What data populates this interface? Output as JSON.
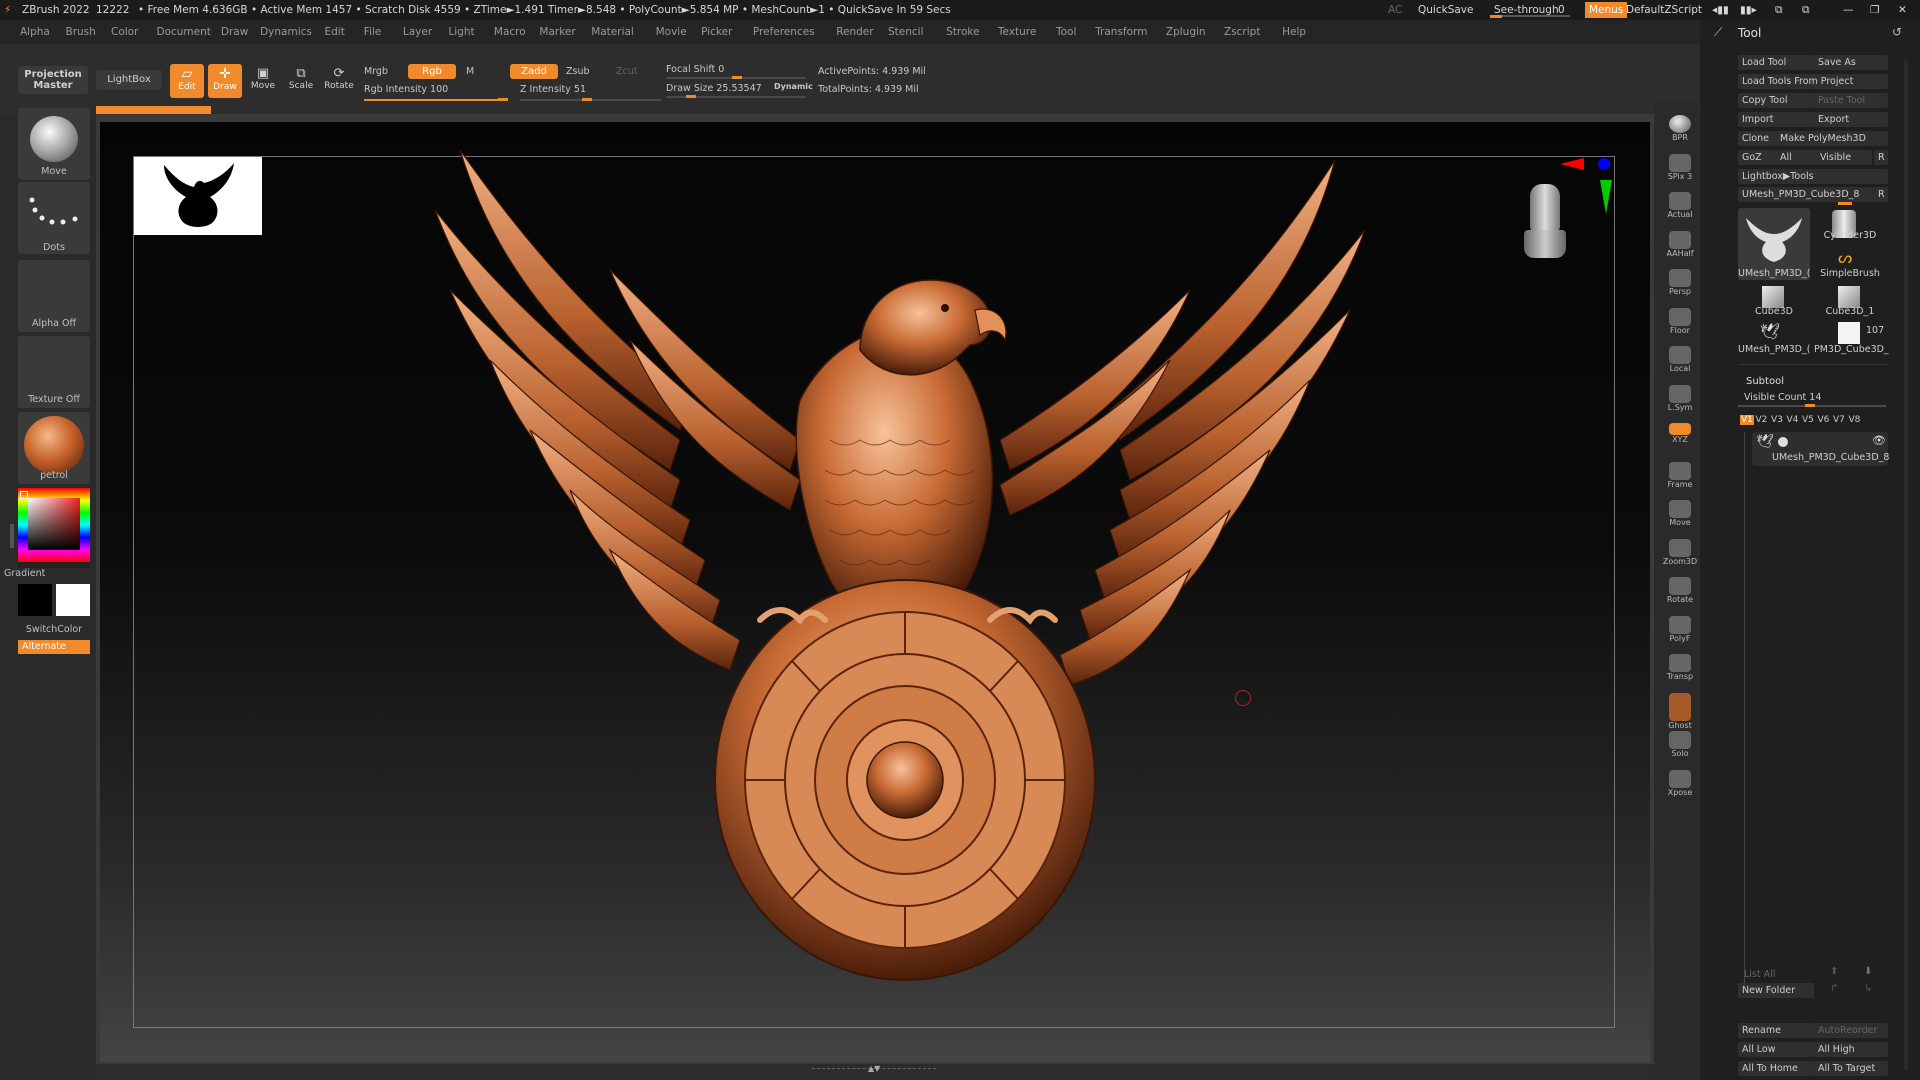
{
  "titlebar": {
    "app": "ZBrush 2022",
    "num": "12222",
    "stats": "• Free Mem 4.636GB • Active Mem 1457 • Scratch Disk 4559 • ZTime►1.491 Timer►8.548 • PolyCount►5.854 MP • MeshCount►1 • QuickSave In 59 Secs",
    "ac": "AC",
    "quicksave": "QuickSave",
    "see_through": "See-through",
    "see_through_value": "0",
    "menus": "Menus",
    "script": "DefaultZScript"
  },
  "menubar": [
    "Alpha",
    "Brush",
    "Color",
    "Document",
    "Draw",
    "Dynamics",
    "Edit",
    "File",
    "Layer",
    "Light",
    "Macro",
    "Marker",
    "Material",
    "Movie",
    "Picker",
    "Preferences",
    "Render",
    "Stencil",
    "Stroke",
    "Texture",
    "Tool",
    "Transform",
    "Zplugin",
    "Zscript",
    "Help"
  ],
  "shelf": {
    "projection_master": "Projection Master",
    "lightbox": "LightBox",
    "edit": "Edit",
    "draw": "Draw",
    "move": "Move",
    "scale": "Scale",
    "rotate": "Rotate",
    "mrgb": "Mrgb",
    "rgb": "Rgb",
    "m": "M",
    "rgb_intensity": "Rgb Intensity 100",
    "zadd": "Zadd",
    "zsub": "Zsub",
    "zcut": "Zcut",
    "z_intensity": "Z Intensity 51",
    "focal_shift": "Focal Shift 0",
    "draw_size": "Draw Size 25.53547",
    "dynamic": "Dynamic",
    "active_points": "ActivePoints: 4.939 Mil",
    "total_points": "TotalPoints: 4.939 Mil",
    "rgb_intensity_value": 100,
    "z_intensity_value": 51
  },
  "lefttray": {
    "brush": "Move",
    "stroke": "Dots",
    "alpha": "Alpha Off",
    "texture": "Texture Off",
    "material": "petrol",
    "gradient": "Gradient",
    "switchcolor": "SwitchColor",
    "alternate": "Alternate"
  },
  "righttools": [
    "BPR",
    "SPix 3",
    "Actual",
    "AAHalf",
    "Persp",
    "Floor",
    "Local",
    "L.Sym",
    "XYZ",
    "Frame",
    "Move",
    "Zoom3D",
    "Rotate",
    "PolyF",
    "Transp",
    "Ghost",
    "Solo",
    "Xpose"
  ],
  "toolpalette": {
    "title": "Tool",
    "load_tool": "Load Tool",
    "save_as": "Save As",
    "load_from_project": "Load Tools From Project",
    "copy_tool": "Copy Tool",
    "paste_tool": "Paste Tool",
    "import": "Import",
    "export": "Export",
    "clone": "Clone",
    "make_polymesh": "Make PolyMesh3D",
    "goz": "GoZ",
    "all": "All",
    "visible": "Visible",
    "r": "R",
    "lightbox_tools": "Lightbox▶Tools",
    "current_tool": "UMesh_PM3D_Cube3D_8",
    "tools": [
      {
        "name": "UMesh_PM3D_(",
        "icon": "eagle-icon"
      },
      {
        "name": "Cylinder3D",
        "icon": "cylinder-icon"
      },
      {
        "name": "SimpleBrush",
        "icon": "simplebrush-icon"
      },
      {
        "name": "Cube3D",
        "icon": "cube-icon"
      },
      {
        "name": "Cube3D_1",
        "icon": "cube-icon"
      },
      {
        "name": "UMesh_PM3D_(",
        "icon": "eagle-icon"
      },
      {
        "name": "PM3D_Cube3D_",
        "icon": "white-cube-icon"
      }
    ],
    "tool_count": "107",
    "subtool": "Subtool",
    "visible_count": "Visible Count 14",
    "visible_count_value": 14,
    "versions": [
      "V1",
      "V2",
      "V3",
      "V4",
      "V5",
      "V6",
      "V7",
      "V8"
    ],
    "subtool_name": "UMesh_PM3D_Cube3D_8",
    "list_all": "List All",
    "new_folder": "New Folder",
    "rename": "Rename",
    "autoreorder": "AutoReorder",
    "all_low": "All Low",
    "all_high": "All High",
    "all_to_home": "All To Home",
    "all_to_target": "All To Target"
  },
  "colors": {
    "accent": "#f08a2a",
    "bronze": "#c8723a",
    "bg": "#2c2c2c"
  }
}
